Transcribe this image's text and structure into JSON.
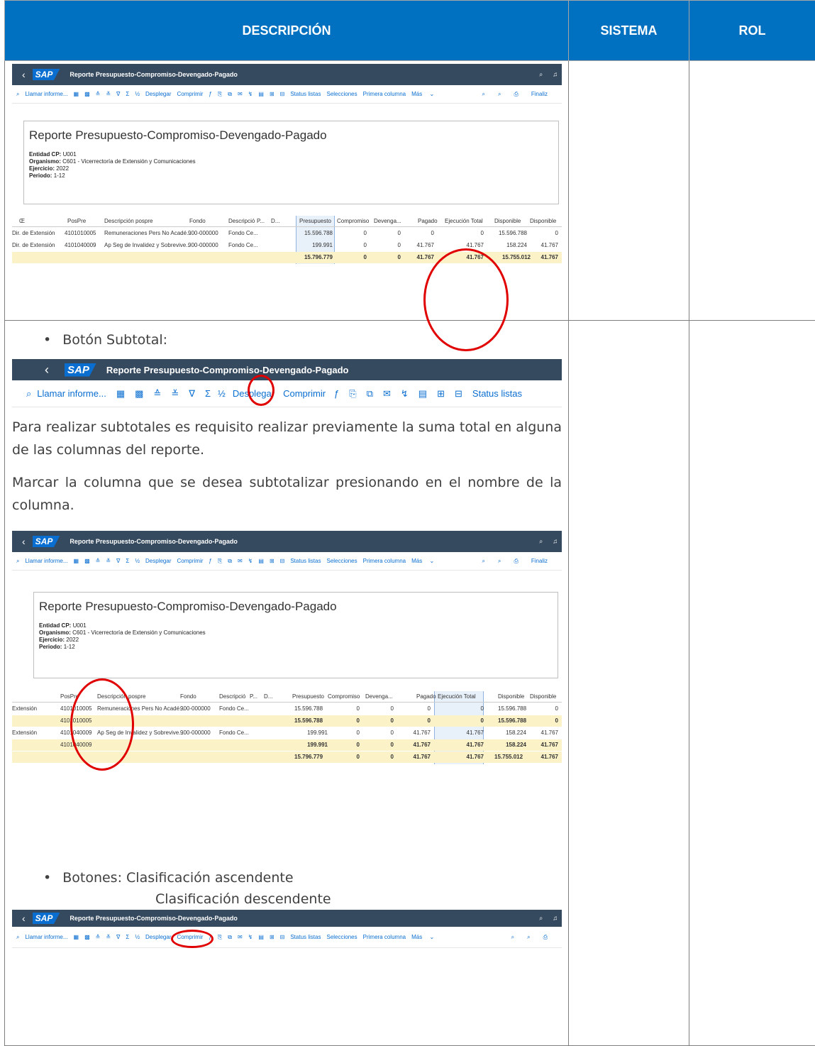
{
  "headers": {
    "description": "DESCRIPCIÓN",
    "system": "SISTEMA",
    "role": "ROL"
  },
  "sap": {
    "back": "‹",
    "logo": "SAP",
    "title": "Reporte Presupuesto-Compromiso-Devengado-Pagado",
    "toolbar": {
      "call_report": "Llamar informe...",
      "expand": "Desplegar",
      "compress": "Comprimir",
      "status_lists": "Status listas",
      "selections": "Selecciones",
      "first_column": "Primera columna",
      "more": "Más",
      "finalize": "Finaliz"
    },
    "report": {
      "title": "Reporte Presupuesto-Compromiso-Devengado-Pagado",
      "entidad_label": "Entidad CP:",
      "entidad_value": "U001",
      "organismo_label": "Organismo:",
      "organismo_value": "C601 - Vicerrectoría de Extensión y Comunicaciones",
      "ejercicio_label": "Ejercicio:",
      "ejercicio_value": "2022",
      "periodo_label": "Periodo:",
      "periodo_value": "1-12"
    },
    "columns": [
      "PosPre",
      "Descripción pospre",
      "Fondo",
      "Descripció",
      "P...",
      "D...",
      "Presupuesto",
      "Compromiso",
      "Devenga...",
      "Pagado",
      "Ejecución Total",
      "Disponible",
      "Disponible"
    ],
    "grid1": {
      "first_col": "Œ",
      "rows": [
        [
          "Dir. de Extensión",
          "4101010005",
          "Remuneraciones Pers No Acadé...",
          "900-000000",
          "Fondo Ce...",
          "15.596.788",
          "0",
          "0",
          "0",
          "0",
          "15.596.788",
          "0"
        ],
        [
          "Dir. de Extensión",
          "4101040009",
          "Ap Seg de Invalidez y Sobrevive...",
          "900-000000",
          "Fondo Ce...",
          "199.991",
          "0",
          "0",
          "41.767",
          "41.767",
          "158.224",
          "41.767"
        ]
      ],
      "total": [
        "15.796.779",
        "0",
        "0",
        "41.767",
        "41.767",
        "15.755.012",
        "41.767"
      ]
    },
    "grid2": {
      "rows": [
        [
          "Extensión",
          "4101010005",
          "Remuneraciones Pers No Acadé...",
          "900-000000",
          "Fondo Ce...",
          "15.596.788",
          "0",
          "0",
          "0",
          "0",
          "15.596.788",
          "0"
        ],
        [
          "",
          "4101010005",
          "",
          "",
          "",
          "15.596.788",
          "0",
          "0",
          "0",
          "0",
          "15.596.788",
          "0"
        ],
        [
          "Extensión",
          "4101040009",
          "Ap Seg de Invalidez y Sobrevive...",
          "900-000000",
          "Fondo Ce...",
          "199.991",
          "0",
          "0",
          "41.767",
          "41.767",
          "158.224",
          "41.767"
        ],
        [
          "",
          "4101040009",
          "",
          "",
          "",
          "199.991",
          "0",
          "0",
          "41.767",
          "41.767",
          "158.224",
          "41.767"
        ]
      ],
      "total": [
        "15.796.779",
        "0",
        "0",
        "41.767",
        "41.767",
        "15.755.012",
        "41.767"
      ]
    }
  },
  "text": {
    "bullet1": "Botón Subtotal:",
    "para1": "Para realizar subtotales es requisito realizar previamente la suma total en alguna de las columnas del reporte.",
    "para2": "Marcar la columna que se desea subtotalizar presionando en el nombre de la columna.",
    "bullet2_line1": "Botones: Clasificación ascendente",
    "bullet2_line2": "Clasificación descendente"
  },
  "icons": {
    "accent": "#0a6ed1",
    "shell": "#354a5f",
    "header_blue": "#0070c0",
    "highlight_red": "#e00000"
  }
}
